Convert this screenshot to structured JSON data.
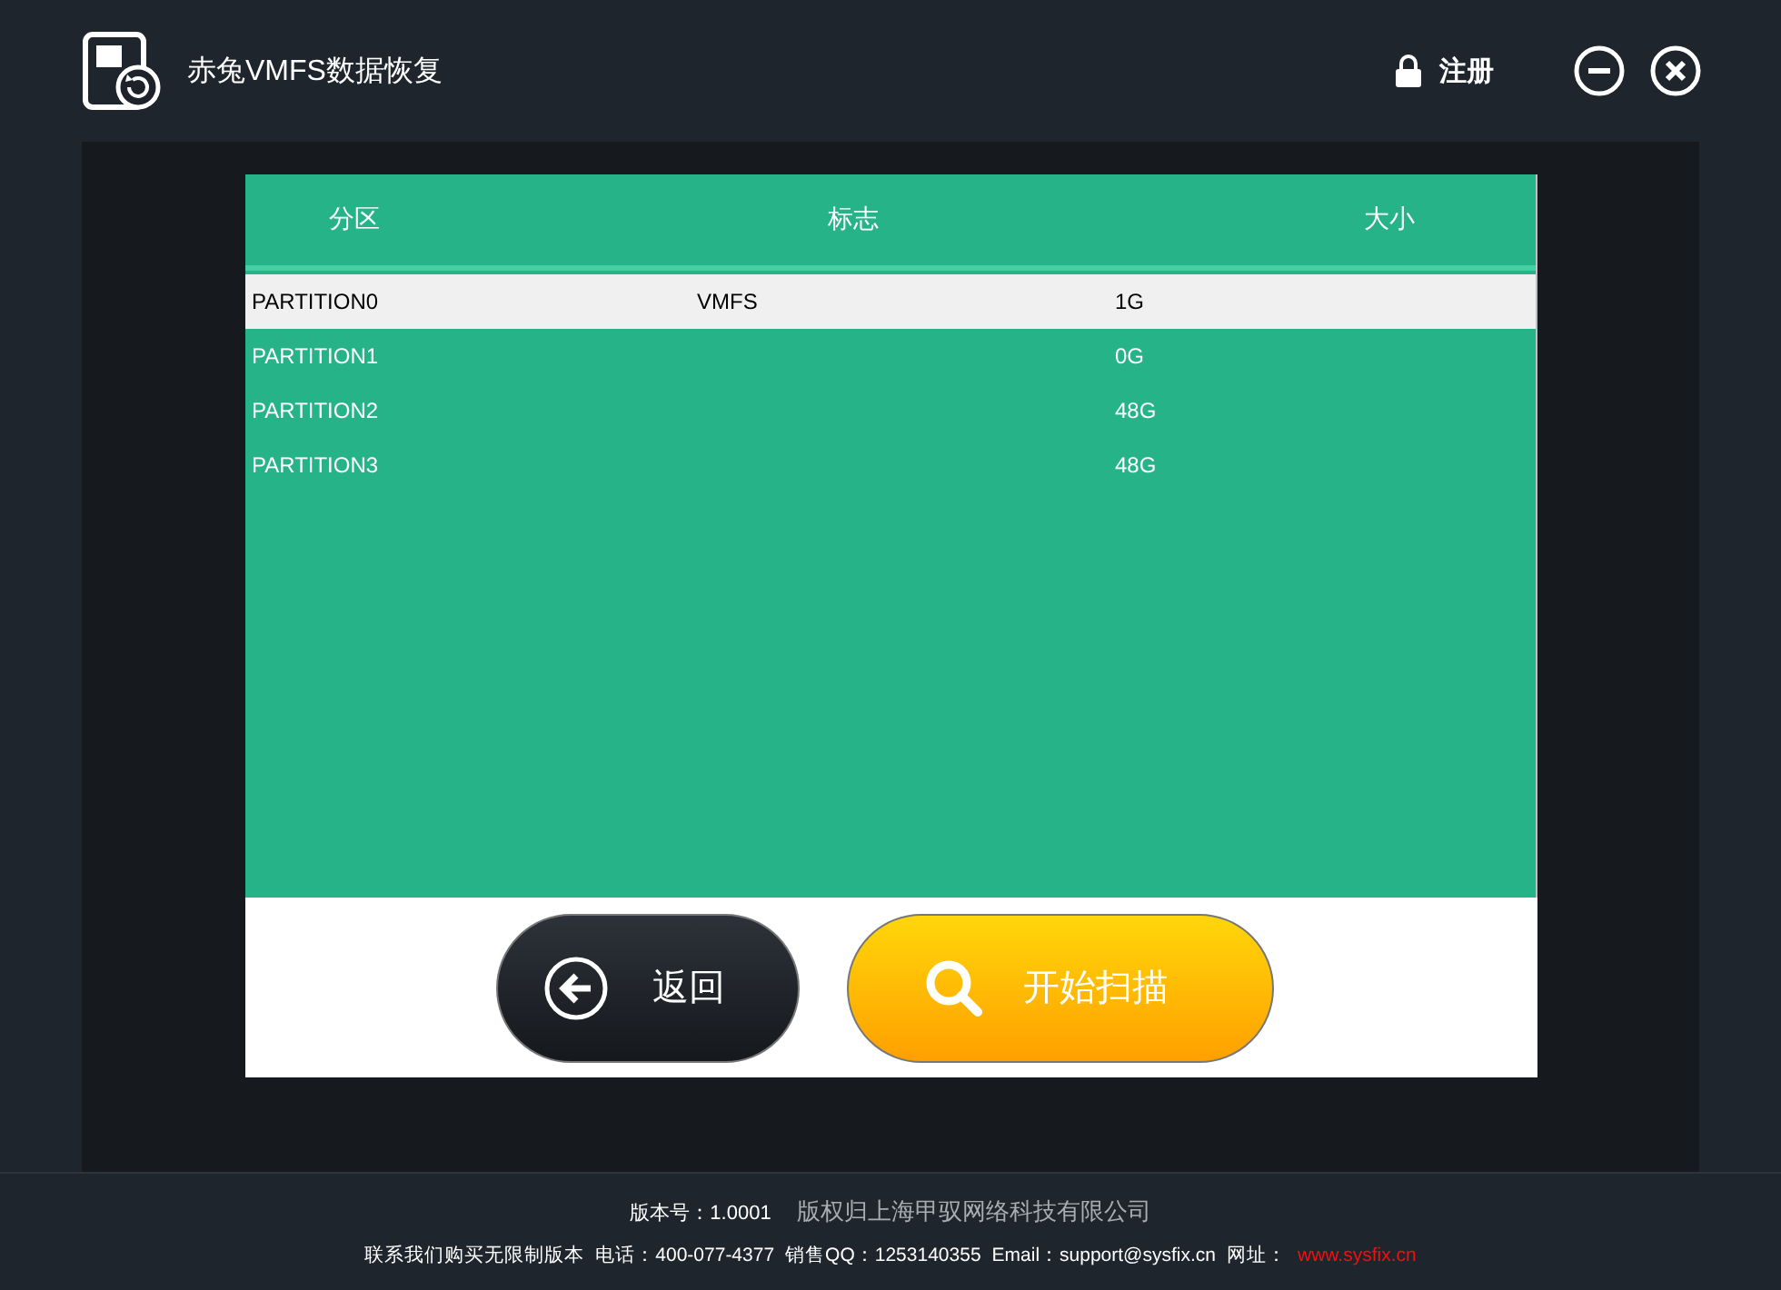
{
  "window": {
    "title": "赤兔VMFS数据恢复",
    "register": "注册"
  },
  "table": {
    "columns": [
      "分区",
      "标志",
      "大小"
    ],
    "rows": [
      {
        "cells": [
          "PARTITION0",
          "VMFS",
          "1G"
        ],
        "selected": true
      },
      {
        "cells": [
          "PARTITION1",
          "",
          "0G"
        ],
        "selected": false
      },
      {
        "cells": [
          "PARTITION2",
          "",
          "48G"
        ],
        "selected": false
      },
      {
        "cells": [
          "PARTITION3",
          "",
          "48G"
        ],
        "selected": false
      }
    ]
  },
  "buttons": [
    {
      "kind": "back",
      "label": "返回"
    },
    {
      "kind": "scan",
      "label": "开始扫描"
    }
  ],
  "footer": {
    "version": "版本号：1.0001",
    "copyright": "版权归上海甲驭网络科技有限公司",
    "contact": "联系我们购买无限制版本",
    "phone": "电话：400-077-4377",
    "qq": "销售QQ：1253140355",
    "email": "Email：support@sysfix.cn",
    "site_label": "网址：",
    "site": "www.sysfix.cn"
  }
}
